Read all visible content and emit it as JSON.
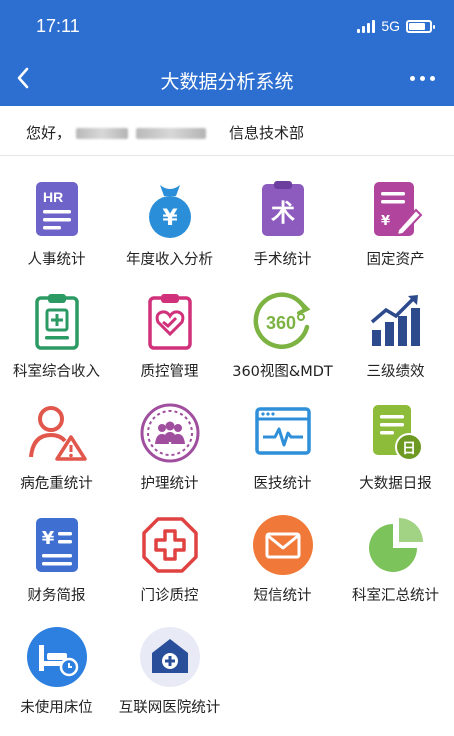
{
  "status": {
    "time": "17:11",
    "network": "5G",
    "battery_level": 0.8
  },
  "nav": {
    "title": "大数据分析系统",
    "back_icon": "chevron-left-icon",
    "more_icon": "more-dots-icon"
  },
  "user": {
    "greeting": "您好，",
    "department": "信息技术部"
  },
  "apps": [
    {
      "label": "人事统计",
      "icon": "hr-document-icon",
      "color": "#6e63c9"
    },
    {
      "label": "年度收入分析",
      "icon": "money-bag-yuan-icon",
      "color": "#2a8fd8"
    },
    {
      "label": "手术统计",
      "icon": "surgery-clipboard-icon",
      "color": "#8c5bbd"
    },
    {
      "label": "固定资产",
      "icon": "asset-document-icon",
      "color": "#b1449c"
    },
    {
      "label": "科室综合收入",
      "icon": "medical-clipboard-icon",
      "color": "#2b9a63"
    },
    {
      "label": "质控管理",
      "icon": "heart-clipboard-icon",
      "color": "#d1307a"
    },
    {
      "label": "360视图&MDT",
      "icon": "360-view-icon",
      "color": "#7cb342"
    },
    {
      "label": "三级绩效",
      "icon": "bar-chart-growth-icon",
      "color": "#2d4b8c"
    },
    {
      "label": "病危重统计",
      "icon": "patient-warning-icon",
      "color": "#e2574c"
    },
    {
      "label": "护理统计",
      "icon": "nursing-group-icon",
      "color": "#a04e9e"
    },
    {
      "label": "医技统计",
      "icon": "monitor-pulse-icon",
      "color": "#2f8fd8"
    },
    {
      "label": "大数据日报",
      "icon": "daily-report-icon",
      "color": "#8dbb3a"
    },
    {
      "label": "财务简报",
      "icon": "finance-document-icon",
      "color": "#3f6fd0"
    },
    {
      "label": "门诊质控",
      "icon": "medical-cross-icon",
      "color": "#e04242"
    },
    {
      "label": "短信统计",
      "icon": "envelope-icon",
      "color": "#f0793a"
    },
    {
      "label": "科室汇总统计",
      "icon": "pie-chart-icon",
      "color": "#7dc35b"
    },
    {
      "label": "未使用床位",
      "icon": "bed-clock-icon",
      "color": "#2d7fe0"
    },
    {
      "label": "互联网医院统计",
      "icon": "hospital-home-icon",
      "color": "#2a4f9a"
    }
  ]
}
